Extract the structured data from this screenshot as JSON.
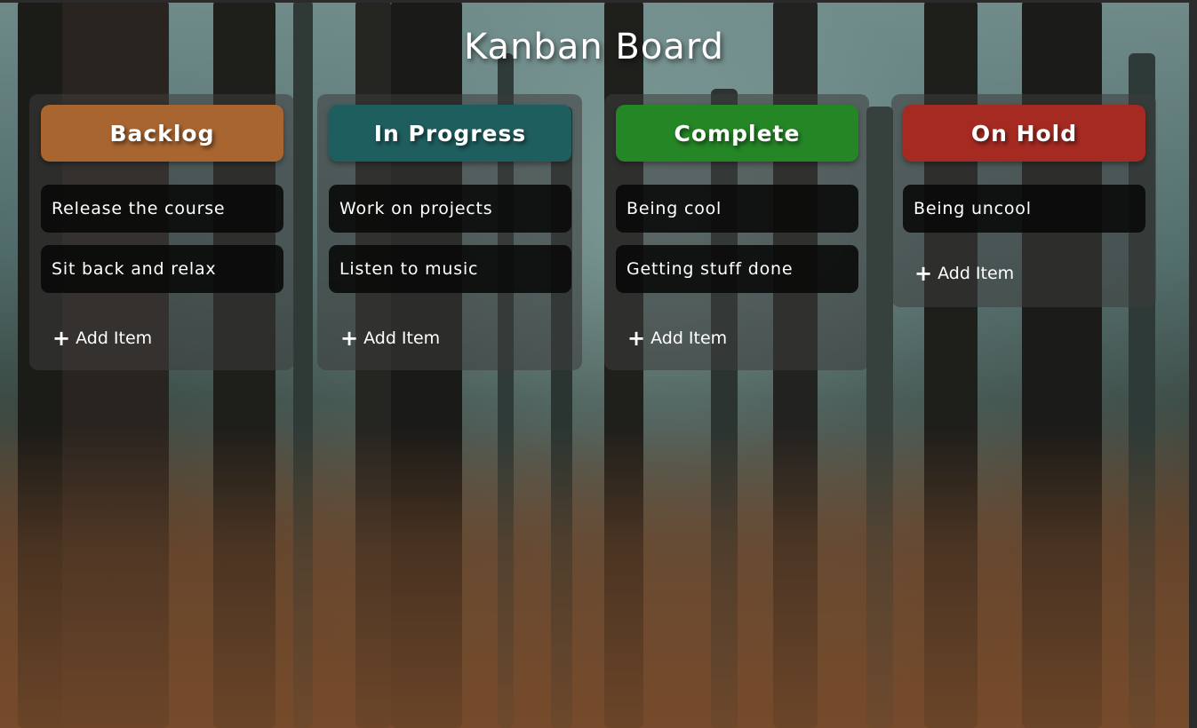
{
  "board": {
    "title": "Kanban Board"
  },
  "columns": [
    {
      "title": "Backlog",
      "color": "#A86530",
      "items": [
        "Release the course",
        "Sit back and relax"
      ],
      "add_label": "Add Item"
    },
    {
      "title": "In Progress",
      "color": "#1F5E5F",
      "items": [
        "Work on projects",
        "Listen to music"
      ],
      "add_label": "Add Item"
    },
    {
      "title": "Complete",
      "color": "#248625",
      "items": [
        "Being cool",
        "Getting stuff done"
      ],
      "add_label": "Add Item"
    },
    {
      "title": "On Hold",
      "color": "#A52A22",
      "items": [
        "Being uncool"
      ],
      "add_label": "Add Item"
    }
  ],
  "icons": {
    "add": "plus-icon"
  }
}
